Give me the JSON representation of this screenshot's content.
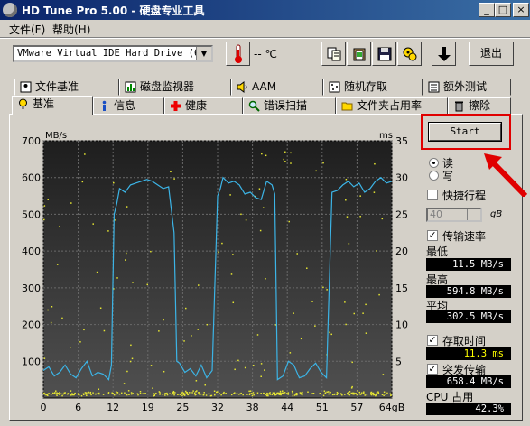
{
  "window": {
    "title": "HD Tune Pro 5.00 - 硬盘专业工具",
    "controls": [
      "_",
      "□",
      "×"
    ]
  },
  "menu": [
    {
      "label": "文件(F)"
    },
    {
      "label": "帮助(H)"
    }
  ],
  "toolbar": {
    "drive": "VMware Virtual IDE Hard Drive (64",
    "temperature": "-- ℃",
    "exit_label": "退出"
  },
  "tabs_row1": [
    {
      "label": "文件基准",
      "icon": "file-benchmark-icon"
    },
    {
      "label": "磁盘监视器",
      "icon": "disk-monitor-icon"
    },
    {
      "label": "AAM",
      "icon": "speaker-icon"
    },
    {
      "label": "随机存取",
      "icon": "random-access-icon"
    },
    {
      "label": "额外测试",
      "icon": "extra-tests-icon"
    }
  ],
  "tabs_row2": [
    {
      "label": "基准",
      "icon": "benchmark-icon",
      "active": true
    },
    {
      "label": "信息",
      "icon": "info-icon"
    },
    {
      "label": "健康",
      "icon": "health-icon"
    },
    {
      "label": "错误扫描",
      "icon": "error-scan-icon"
    },
    {
      "label": "文件夹占用率",
      "icon": "folder-icon"
    },
    {
      "label": "擦除",
      "icon": "erase-icon"
    }
  ],
  "controls": {
    "start_label": "Start",
    "read_label": "读",
    "write_label": "写",
    "short_stroke_label": "快捷行程",
    "short_stroke_value": "40",
    "short_stroke_unit": "gB",
    "transfer_rate_label": "传输速率",
    "min_label": "最低",
    "min_value": "11.5 MB/s",
    "max_label": "最高",
    "max_value": "594.8 MB/s",
    "avg_label": "平均",
    "avg_value": "302.5 MB/s",
    "access_time_label": "存取时间",
    "access_time_value": "11.3 ms",
    "burst_rate_label": "突发传输",
    "burst_rate_value": "658.4 MB/s",
    "cpu_label": "CPU 占用",
    "cpu_value": "42.3%"
  },
  "chart_data": {
    "type": "line",
    "ylabel": "MB/s",
    "y2label": "ms",
    "xlabel": "gB",
    "xlim": [
      0,
      64
    ],
    "ylim": [
      0,
      700
    ],
    "y2lim": [
      0,
      35
    ],
    "x_ticks": [
      "0",
      "6",
      "12",
      "19",
      "25",
      "32",
      "38",
      "44",
      "51",
      "57",
      "64gB"
    ],
    "y_ticks": [
      "100",
      "200",
      "300",
      "400",
      "500",
      "600",
      "700"
    ],
    "y2_ticks": [
      "5",
      "10",
      "15",
      "20",
      "25",
      "30",
      "35"
    ],
    "line_color": "#3cb4e6",
    "point_color": "#e6e632",
    "series": [
      {
        "x": [
          0,
          1,
          2,
          3,
          4,
          5,
          6,
          7,
          8,
          9,
          10,
          11,
          12,
          12.5,
          13,
          13.5,
          14,
          15,
          16,
          17,
          18,
          19,
          20,
          21,
          22,
          23,
          24,
          24.5,
          25,
          26,
          27,
          28,
          29,
          30,
          31,
          32,
          32.5,
          33,
          34,
          35,
          36,
          37,
          38,
          39,
          40,
          41,
          42,
          42.5,
          43,
          44,
          45,
          46,
          47,
          48,
          49,
          50,
          51,
          52,
          53,
          54,
          55,
          56,
          57,
          58,
          59,
          60,
          61,
          62,
          63,
          64
        ],
        "values": [
          75,
          85,
          60,
          70,
          90,
          65,
          55,
          80,
          100,
          60,
          70,
          65,
          50,
          90,
          500,
          530,
          570,
          560,
          580,
          585,
          590,
          595,
          590,
          580,
          570,
          575,
          450,
          100,
          95,
          70,
          80,
          60,
          90,
          55,
          75,
          550,
          570,
          600,
          585,
          590,
          580,
          555,
          560,
          545,
          540,
          590,
          580,
          555,
          50,
          60,
          100,
          90,
          55,
          60,
          80,
          95,
          70,
          55,
          560,
          565,
          580,
          590,
          575,
          585,
          560,
          570,
          590,
          600,
          585,
          590
        ]
      }
    ],
    "access_time_points": "scatter of yellow dots, ms axis, mostly 0-30 ms"
  }
}
